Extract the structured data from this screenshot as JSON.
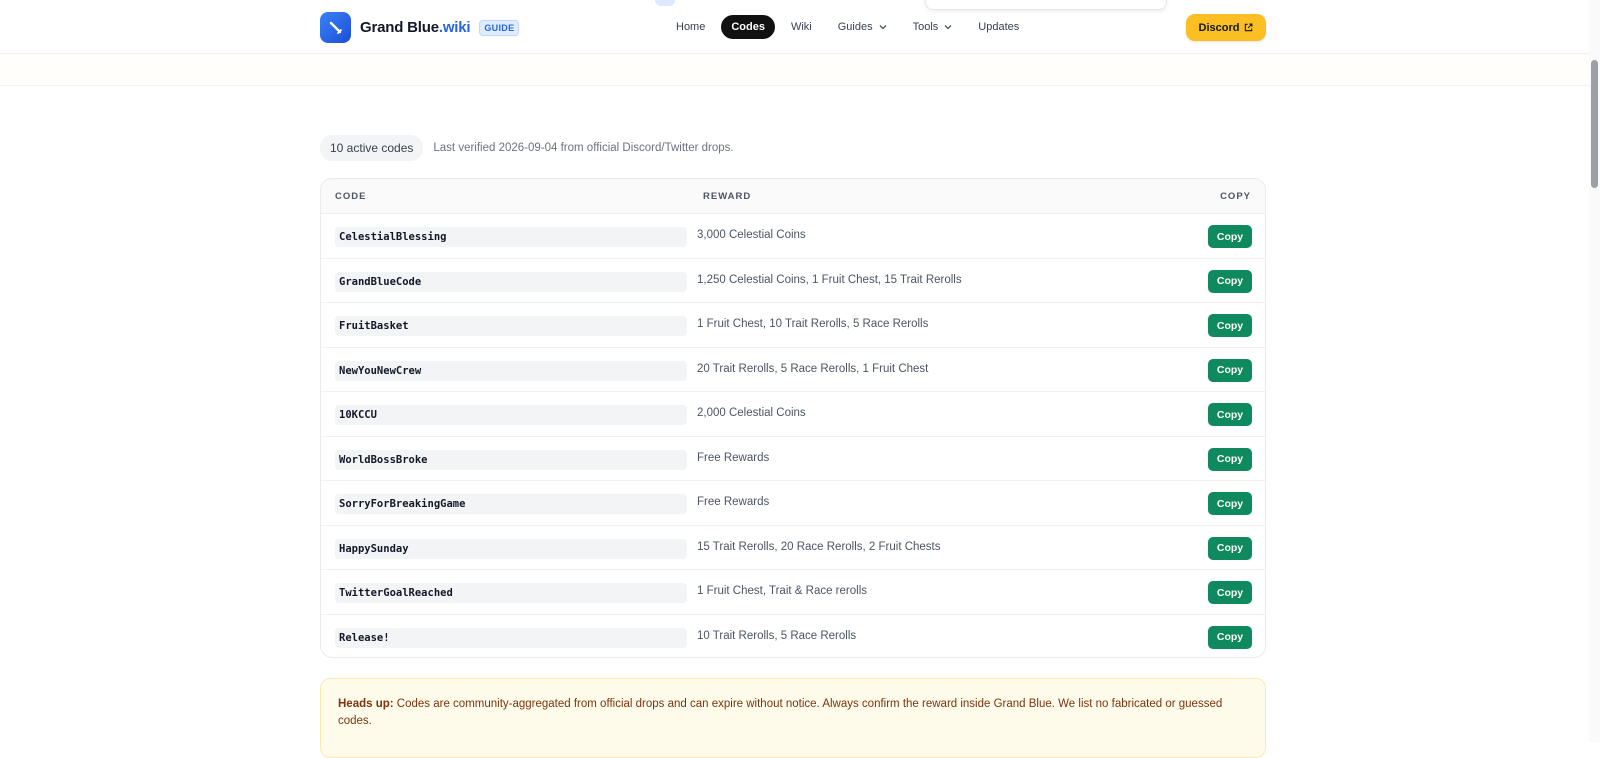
{
  "header": {
    "brand_name": "Grand Blue",
    "brand_suffix": ".wiki",
    "badge": "GUIDE",
    "nav": [
      {
        "label": "Home"
      },
      {
        "label": "Codes"
      },
      {
        "label": "Wiki"
      },
      {
        "label": "Guides"
      },
      {
        "label": "Tools"
      },
      {
        "label": "Updates"
      }
    ],
    "discord_label": "Discord"
  },
  "summary": {
    "count_label": "10 active codes",
    "verified_text": "Last verified 2026-09-04 from official Discord/Twitter drops."
  },
  "table": {
    "headers": {
      "code": "CODE",
      "reward": "REWARD",
      "copy": "COPY"
    },
    "copy_label": "Copy",
    "rows": [
      {
        "code": "CelestialBlessing",
        "reward": "3,000 Celestial Coins"
      },
      {
        "code": "GrandBlueCode",
        "reward": "1,250 Celestial Coins, 1 Fruit Chest, 15 Trait Rerolls"
      },
      {
        "code": "FruitBasket",
        "reward": "1 Fruit Chest, 10 Trait Rerolls, 5 Race Rerolls"
      },
      {
        "code": "NewYouNewCrew",
        "reward": "20 Trait Rerolls, 5 Race Rerolls, 1 Fruit Chest"
      },
      {
        "code": "10KCCU",
        "reward": "2,000 Celestial Coins"
      },
      {
        "code": "WorldBossBroke",
        "reward": "Free Rewards"
      },
      {
        "code": "SorryForBreakingGame",
        "reward": "Free Rewards"
      },
      {
        "code": "HappySunday",
        "reward": "15 Trait Rerolls, 20 Race Rerolls, 2 Fruit Chests"
      },
      {
        "code": "TwitterGoalReached",
        "reward": "1 Fruit Chest, Trait & Race rerolls"
      },
      {
        "code": "Release!",
        "reward": "10 Trait Rerolls, 5 Race Rerolls"
      }
    ]
  },
  "notice": {
    "label": "Heads up:",
    "text": "Codes are community-aggregated from official drops and can expire without notice. Always confirm the reward inside Grand Blue. We list no fabricated or guessed codes."
  },
  "colors": {
    "accent_blue": "#2563eb",
    "copy_green": "#0f8a5f",
    "discord_yellow": "#fbbf24",
    "active_nav": "#111111"
  },
  "icons": {
    "logo": "sword-icon",
    "dropdown": "chevron-down-icon",
    "external": "external-link-icon"
  }
}
